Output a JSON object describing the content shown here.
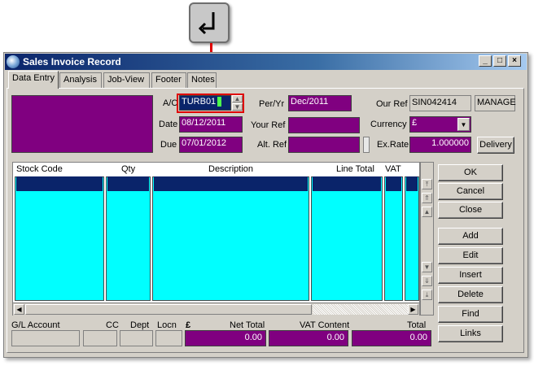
{
  "window": {
    "title": "Sales Invoice Record",
    "controls": [
      "_",
      "□",
      "×"
    ]
  },
  "tabs": [
    "Data Entry",
    "Analysis",
    "Job-View",
    "Footer",
    "Notes"
  ],
  "header": {
    "ac_label": "A/C",
    "ac_value": "TURB01",
    "per_yr_label": "Per/Yr",
    "per_yr_value": "Dec/2011",
    "our_ref_label": "Our Ref",
    "our_ref_value": "SIN042414",
    "manage_label": "MANAGE",
    "date_label": "Date",
    "date_value": "08/12/2011",
    "your_ref_label": "Your Ref",
    "your_ref_value": "",
    "currency_label": "Currency",
    "currency_value": "£",
    "due_label": "Due",
    "due_value": "07/01/2012",
    "alt_ref_label": "Alt. Ref",
    "alt_ref_value": "",
    "ex_rate_label": "Ex.Rate",
    "ex_rate_value": "1.000000",
    "delivery_label": "Delivery"
  },
  "grid": {
    "columns": [
      "Stock Code",
      "Qty",
      "Description",
      "Line Total",
      "VAT"
    ]
  },
  "buttons": [
    "OK",
    "Cancel",
    "Close",
    "Add",
    "Edit",
    "Insert",
    "Delete",
    "Find",
    "Links"
  ],
  "footer": {
    "gl_account_label": "G/L Account",
    "cc_label": "CC",
    "dept_label": "Dept",
    "locn_label": "Locn",
    "currency_symbol": "£",
    "net_total_label": "Net Total",
    "net_total_value": "0.00",
    "vat_content_label": "VAT Content",
    "vat_content_value": "0.00",
    "total_label": "Total",
    "total_value": "0.00"
  },
  "colors": {
    "field_purple": "#800080",
    "grid_cyan": "#00ffff",
    "highlight_red": "#e00000",
    "title_blue": "#0a246a"
  },
  "icons": [
    "return-arrow-icon",
    "app-globe-icon",
    "spin-up-icon",
    "spin-down-icon",
    "dropdown-arrow-icon"
  ]
}
